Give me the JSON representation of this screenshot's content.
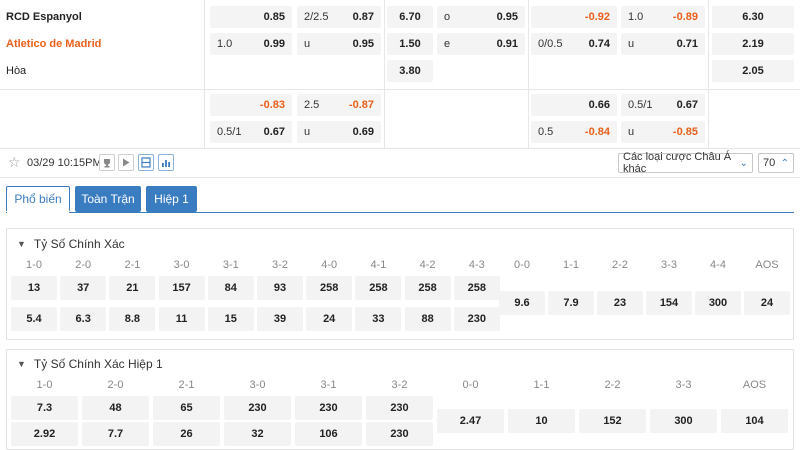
{
  "match": {
    "home": "RCD Espanyol",
    "away": "Atletico de Madrid",
    "draw": "Hòa"
  },
  "odds": {
    "r1": {
      "a_v": "0.85",
      "b_h": "2/2.5",
      "b_v": "0.87",
      "c_v": "6.70",
      "d_h": "o",
      "d_v": "0.95",
      "e_v": "-0.92",
      "f_h": "1.0",
      "f_v": "-0.89",
      "g_v": "6.30"
    },
    "r2": {
      "a_h": "1.0",
      "a_v": "0.99",
      "b_h": "u",
      "b_v": "0.95",
      "c_v": "1.50",
      "d_h": "e",
      "d_v": "0.91",
      "e_h": "0/0.5",
      "e_v": "0.74",
      "f_h": "u",
      "f_v": "0.71",
      "g_v": "2.19"
    },
    "r3": {
      "c_v": "3.80",
      "g_v": "2.05"
    },
    "r4": {
      "a_v": "-0.83",
      "b_h": "2.5",
      "b_v": "-0.87",
      "e_v": "0.66",
      "f_h": "0.5/1",
      "f_v": "0.67"
    },
    "r5": {
      "a_h": "0.5/1",
      "a_v": "0.67",
      "b_h": "u",
      "b_v": "0.69",
      "e_h": "0.5",
      "e_v": "-0.84",
      "f_h": "u",
      "f_v": "-0.85"
    }
  },
  "toolbar": {
    "datetime": "03/29 10:15PM",
    "market_select": "Các loại cược Châu Á khác",
    "page_select": "70",
    "icons": [
      "star-icon",
      "trophy-icon",
      "play-icon",
      "lineup-icon",
      "stats-icon"
    ]
  },
  "tabs": [
    "Phổ biến",
    "Toàn Trận",
    "Hiệp 1"
  ],
  "section1": {
    "title": "Tỷ Số Chính Xác",
    "home_heads": [
      "1-0",
      "2-0",
      "2-1",
      "3-0",
      "3-1",
      "3-2",
      "4-0",
      "4-1",
      "4-2",
      "4-3"
    ],
    "home_odds": [
      "13",
      "37",
      "21",
      "157",
      "84",
      "93",
      "258",
      "258",
      "258",
      "258"
    ],
    "away_odds": [
      "5.4",
      "6.3",
      "8.8",
      "11",
      "15",
      "39",
      "24",
      "33",
      "88",
      "230"
    ],
    "draw_heads": [
      "0-0",
      "1-1",
      "2-2",
      "3-3",
      "4-4",
      "AOS"
    ],
    "draw_odds": [
      "9.6",
      "7.9",
      "23",
      "154",
      "300",
      "24"
    ]
  },
  "section2": {
    "title": "Tỷ Số Chính Xác Hiệp 1",
    "home_heads": [
      "1-0",
      "2-0",
      "2-1",
      "3-0",
      "3-1",
      "3-2"
    ],
    "home_odds": [
      "7.3",
      "48",
      "65",
      "230",
      "230",
      "230"
    ],
    "away_odds": [
      "2.92",
      "7.7",
      "26",
      "32",
      "106",
      "230"
    ],
    "draw_heads": [
      "0-0",
      "1-1",
      "2-2",
      "3-3",
      "AOS"
    ],
    "draw_odds": [
      "2.47",
      "10",
      "152",
      "300",
      "104"
    ]
  },
  "colors": {
    "accent": "#3a7cc0",
    "away_team": "#e8601c",
    "negative_odds": "#e8601c"
  }
}
